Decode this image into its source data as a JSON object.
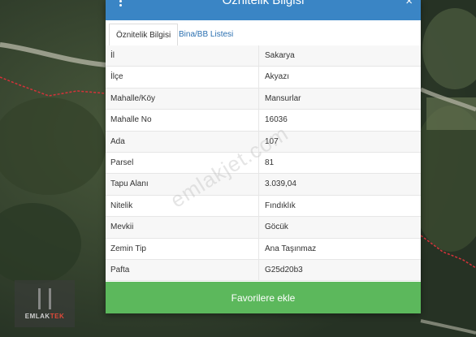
{
  "modal": {
    "title": "Öznitelik Bilgisi",
    "close_symbol": "×",
    "tabs": [
      {
        "label": "Öznitelik Bilgisi",
        "active": true
      },
      {
        "label": "Bina/BB Listesi",
        "active": false
      }
    ],
    "rows": [
      {
        "key": "İl",
        "value": "Sakarya"
      },
      {
        "key": "İlçe",
        "value": "Akyazı"
      },
      {
        "key": "Mahalle/Köy",
        "value": "Mansurlar"
      },
      {
        "key": "Mahalle No",
        "value": "16036"
      },
      {
        "key": "Ada",
        "value": "107"
      },
      {
        "key": "Parsel",
        "value": "81"
      },
      {
        "key": "Tapu Alanı",
        "value": "3.039,04"
      },
      {
        "key": "Nitelik",
        "value": "Fındıklık"
      },
      {
        "key": "Mevkii",
        "value": "Göcük"
      },
      {
        "key": "Zemin Tip",
        "value": "Ana Taşınmaz"
      },
      {
        "key": "Pafta",
        "value": "G25d20b3"
      }
    ],
    "favorite_button": "Favorilere ekle"
  },
  "watermark": "emlakjet.com",
  "logo": {
    "text_a": "EMLAK",
    "text_b": "TEK"
  },
  "colors": {
    "header": "#3a85c5",
    "button": "#5cb85c",
    "parcel_line": "#d6323a"
  }
}
